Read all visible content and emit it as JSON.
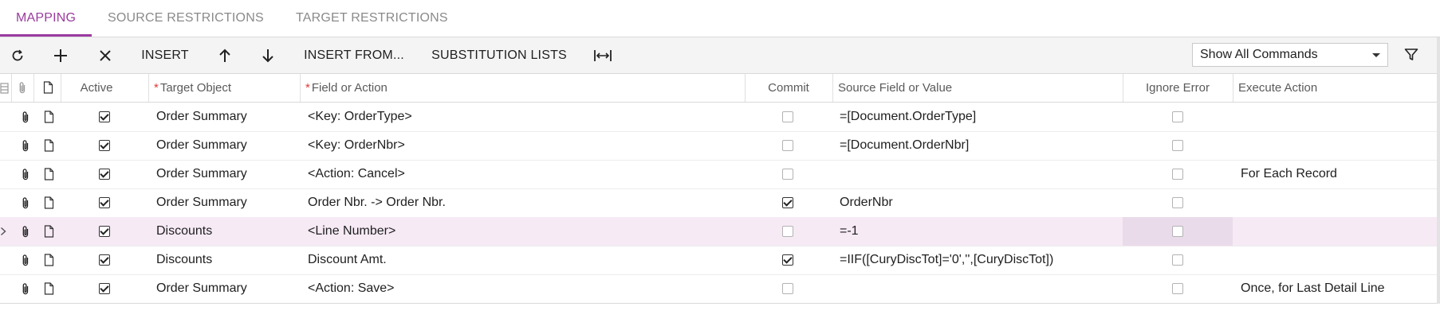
{
  "tabs": [
    {
      "label": "MAPPING",
      "active": true
    },
    {
      "label": "SOURCE RESTRICTIONS",
      "active": false
    },
    {
      "label": "TARGET RESTRICTIONS",
      "active": false
    }
  ],
  "toolbar": {
    "refresh_icon": "refresh-icon",
    "add_icon": "plus-icon",
    "delete_icon": "close-icon",
    "insert_label": "INSERT",
    "move_up_icon": "arrow-up-icon",
    "move_down_icon": "arrow-down-icon",
    "insert_from_label": "INSERT FROM...",
    "substitution_lists_label": "SUBSTITUTION LISTS",
    "fit_columns_icon": "fit-columns-icon",
    "commands_select_value": "Show All Commands",
    "filter_icon": "filter-icon"
  },
  "grid": {
    "columns": {
      "active": "Active",
      "target_object": "Target Object",
      "field_or_action": "Field or Action",
      "commit": "Commit",
      "source_field": "Source Field or Value",
      "ignore_error": "Ignore Error",
      "execute_action": "Execute Action"
    },
    "required_marker": "*",
    "rows": [
      {
        "active": true,
        "target_object": "Order Summary",
        "field_or_action": "<Key: OrderType>",
        "commit": false,
        "source_field": "=[Document.OrderType]",
        "ignore_error": false,
        "execute_action": "",
        "selected": false
      },
      {
        "active": true,
        "target_object": "Order Summary",
        "field_or_action": "<Key: OrderNbr>",
        "commit": false,
        "source_field": "=[Document.OrderNbr]",
        "ignore_error": false,
        "execute_action": "",
        "selected": false
      },
      {
        "active": true,
        "target_object": "Order Summary",
        "field_or_action": "<Action: Cancel>",
        "commit": false,
        "source_field": "",
        "ignore_error": false,
        "execute_action": "For Each Record",
        "selected": false
      },
      {
        "active": true,
        "target_object": "Order Summary",
        "field_or_action": "Order Nbr. -> Order Nbr.",
        "commit": true,
        "source_field": "OrderNbr",
        "ignore_error": false,
        "execute_action": "",
        "selected": false
      },
      {
        "active": true,
        "target_object": "Discounts",
        "field_or_action": "<Line Number>",
        "commit": false,
        "source_field": "=-1",
        "ignore_error": false,
        "execute_action": "",
        "selected": true
      },
      {
        "active": true,
        "target_object": "Discounts",
        "field_or_action": "Discount Amt.",
        "commit": true,
        "source_field": "=IIF([CuryDiscTot]='0','',[CuryDiscTot])",
        "ignore_error": false,
        "execute_action": "",
        "selected": false
      },
      {
        "active": true,
        "target_object": "Order Summary",
        "field_or_action": "<Action: Save>",
        "commit": false,
        "source_field": "",
        "ignore_error": false,
        "execute_action": "Once, for Last Detail Line",
        "selected": false
      }
    ]
  },
  "colors": {
    "accent": "#9b3b9f",
    "selected_row": "#f6eaf5",
    "required": "#e03a3a"
  }
}
